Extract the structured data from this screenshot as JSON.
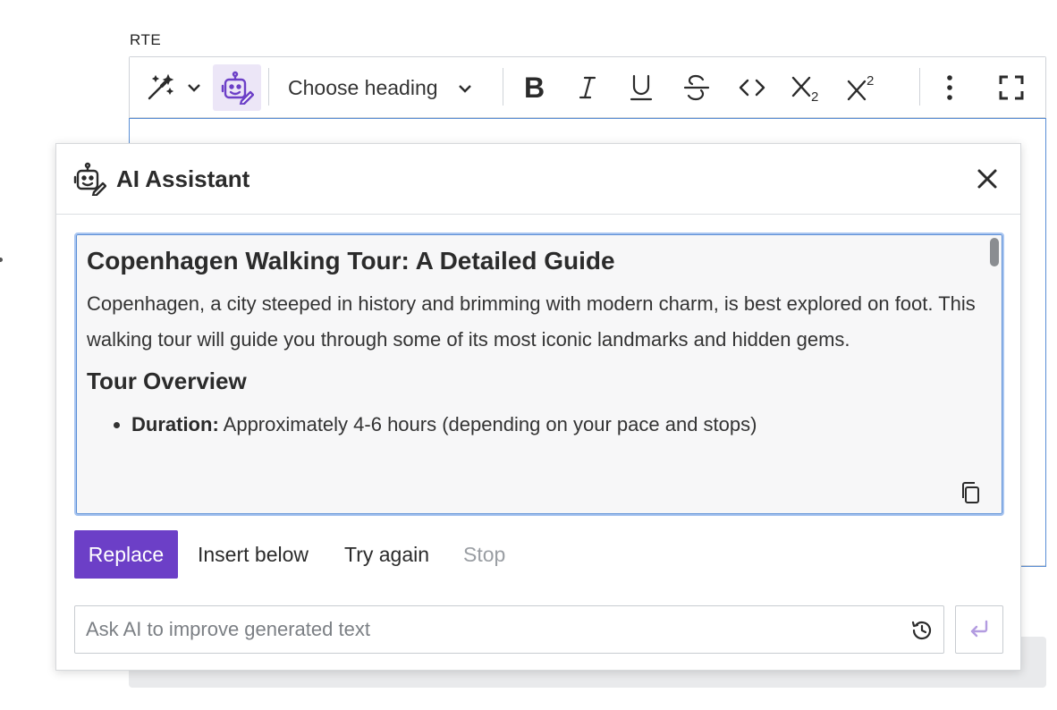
{
  "field": {
    "label": "RTE"
  },
  "toolbar": {
    "heading_select": "Choose heading",
    "icons": [
      "magic-wand-icon",
      "chevron-down-icon",
      "ai-robot-icon",
      "bold-icon",
      "italic-icon",
      "underline-icon",
      "strikethrough-icon",
      "code-icon",
      "subscript-icon",
      "superscript-icon",
      "more-vertical-icon",
      "fullscreen-icon"
    ],
    "active_color": "#ece6f7"
  },
  "dialog": {
    "title": "AI Assistant",
    "response": {
      "title": "Copenhagen Walking Tour: A Detailed Guide",
      "intro": "Copenhagen, a city steeped in history and brimming with modern charm, is best explored on foot. This walking tour will guide you through some of its most iconic landmarks and hidden gems.",
      "section_heading": "Tour Overview",
      "list": [
        {
          "label": "Duration:",
          "text": " Approximately 4-6 hours (depending on your pace and stops)"
        }
      ]
    },
    "actions": {
      "replace": "Replace",
      "insert_below": "Insert below",
      "try_again": "Try again",
      "stop": "Stop"
    },
    "prompt": {
      "placeholder": "Ask AI to improve generated text",
      "value": ""
    },
    "accent_color": "#6c3fc7"
  }
}
